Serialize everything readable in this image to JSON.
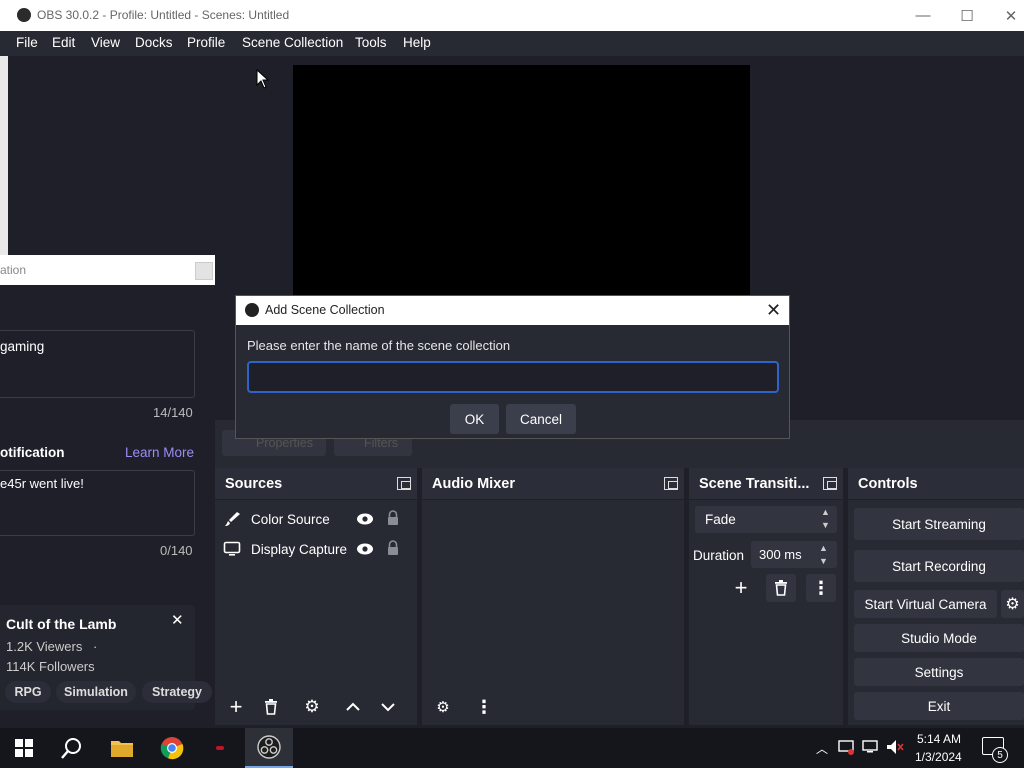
{
  "window": {
    "title": "OBS 30.0.2 - Profile: Untitled - Scenes: Untitled",
    "minimize": "—",
    "maximize": "☐",
    "close": "✕"
  },
  "menu": [
    "File",
    "Edit",
    "View",
    "Docks",
    "Profile",
    "Scene Collection",
    "Tools",
    "Help"
  ],
  "toolbar_ghost": [
    "Properties",
    "Filters"
  ],
  "sources_dock": {
    "title": "Sources",
    "items": [
      {
        "label": "Color Source",
        "icon": "brush-icon"
      },
      {
        "label": "Display Capture",
        "icon": "monitor-icon"
      }
    ]
  },
  "audio_dock": {
    "title": "Audio Mixer"
  },
  "transition_dock": {
    "title": "Scene Transiti...",
    "transition": "Fade",
    "duration_label": "Duration",
    "duration_value": "300 ms"
  },
  "controls_dock": {
    "title": "Controls",
    "buttons": [
      "Start Streaming",
      "Start Recording",
      "Start Virtual Camera",
      "Studio Mode",
      "Settings",
      "Exit"
    ]
  },
  "left_window": {
    "title": "ation",
    "title_field": "gaming",
    "title_count": "14/140",
    "notification_label": "otification",
    "learn_more": "Learn More",
    "notification_text": "e45r went live!",
    "notification_count": "0/140",
    "category": {
      "name": "Cult of the Lamb",
      "viewers": "1.2K Viewers",
      "dot": "·",
      "followers": "114K Followers",
      "tags": [
        "RPG",
        "Simulation",
        "Strategy"
      ]
    }
  },
  "dialog": {
    "title": "Add Scene Collection",
    "prompt": "Please enter the name of the scene collection",
    "input_value": "",
    "ok": "OK",
    "cancel": "Cancel"
  },
  "taskbar": {
    "time": "5:14 AM",
    "date": "1/3/2024",
    "notifications": "5"
  },
  "colors": {
    "accent": "#2f63c8",
    "link": "#9d8cf5",
    "panel": "#272a33",
    "background": "#1e1f29"
  }
}
